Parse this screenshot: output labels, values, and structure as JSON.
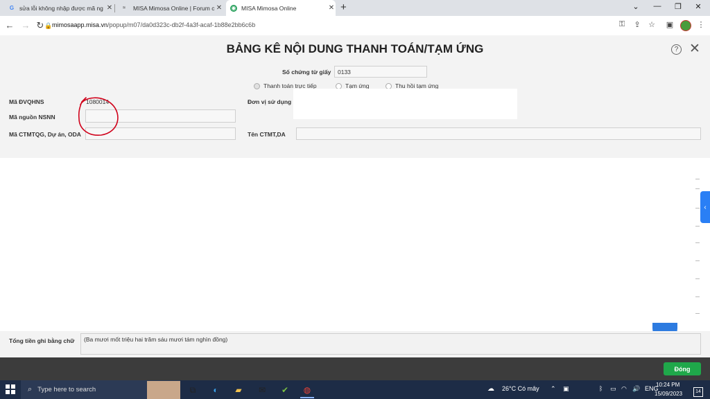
{
  "browser": {
    "tabs": [
      {
        "title": "sửa lỗi không nhập được mã ng",
        "icon": "google-icon"
      },
      {
        "title": "MISA Mimosa Online | Forum c",
        "icon": "misa-icon"
      },
      {
        "title": "MISA Mimosa Online",
        "icon": "mimosa-icon"
      }
    ],
    "new_tab": "+",
    "url_host": "mimosaapp.misa.vn",
    "url_path": "/popup/m07/da0d323c-db2f-4a3f-acaf-1b88e2bb6c6b"
  },
  "form": {
    "title": "BẢNG KÊ NỘI DUNG THANH TOÁN/TẠM ỨNG",
    "so_chung_tu_label": "Số chứng từ giấy",
    "so_chung_tu_value": "0133",
    "radios": [
      {
        "label": "Thanh toán trực tiếp",
        "selected": true
      },
      {
        "label": "Tạm ứng",
        "selected": false
      },
      {
        "label": "Thu hồi tạm ứng",
        "selected": false
      }
    ],
    "ma_dvqhns_label": "Mã ĐVQHNS",
    "ma_dvqhns_value": "1080014",
    "don_vi_label": "Đơn vị sử dụng",
    "ma_nguon_label": "Mã nguồn NSNN",
    "ma_ctmtqg_label": "Mã CTMTQG, Dự án, ODA",
    "ten_ctmt_label": "Tên CTMT,DA",
    "tong_tien_label": "Tổng tiền ghi bằng chữ",
    "tong_tien_value": "(Ba mươi mốt triệu hai trăm sáu mươi tám nghìn đồng)",
    "close_button": "Đóng"
  },
  "taskbar": {
    "search_placeholder": "Type here to search",
    "weather": "26°C  Có mây",
    "time": "10:24 PM",
    "date": "15/09/2023",
    "notification_count": "14"
  },
  "colors": {
    "accent_green": "#1fa84a",
    "accent_blue": "#2a7ff5",
    "annotation_red": "#d0021b"
  }
}
